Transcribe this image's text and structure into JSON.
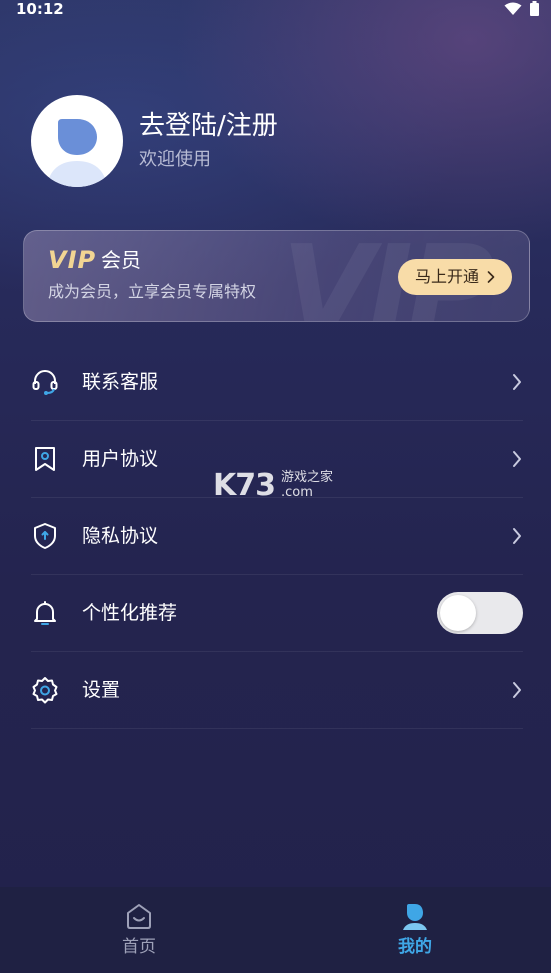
{
  "status_bar": {
    "time": "10:12"
  },
  "profile": {
    "title": "去登陆/注册",
    "subtitle": "欢迎使用"
  },
  "vip": {
    "logo_text": "VIP",
    "title": "会员",
    "description": "成为会员，立享会员专属特权",
    "button_label": "马上开通"
  },
  "menu": {
    "items": [
      {
        "label": "联系客服",
        "icon": "headset-icon",
        "control": "chevron"
      },
      {
        "label": "用户协议",
        "icon": "bookmark-icon",
        "control": "chevron"
      },
      {
        "label": "隐私协议",
        "icon": "shield-icon",
        "control": "chevron"
      },
      {
        "label": "个性化推荐",
        "icon": "bell-icon",
        "control": "toggle",
        "toggle_on": false
      },
      {
        "label": "设置",
        "icon": "gear-icon",
        "control": "chevron"
      }
    ]
  },
  "watermark": {
    "brand": "K73",
    "cn": "游戏之家",
    "domain": ".com"
  },
  "tabbar": {
    "tabs": [
      {
        "label": "首页",
        "icon": "home-icon",
        "active": false
      },
      {
        "label": "我的",
        "icon": "profile-icon",
        "active": true
      }
    ]
  },
  "colors": {
    "accent": "#3fa6e6",
    "vip_gold": "#f2d593",
    "vip_button": "#f8dca8",
    "tab_inactive": "#9ea1b8"
  }
}
